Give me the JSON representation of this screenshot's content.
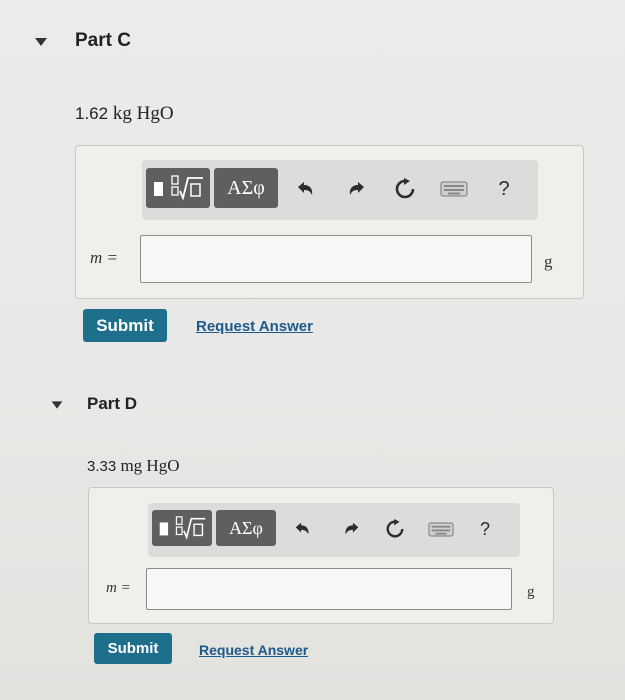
{
  "part_c": {
    "title": "Part C",
    "quantity": "1.62",
    "unit_expr": "kg HgO",
    "toolbar": {
      "greek_label": "ΑΣφ",
      "help_label": "?"
    },
    "var_label": "m =",
    "answer_value": "",
    "answer_unit": "g",
    "submit_label": "Submit",
    "request_label": "Request Answer"
  },
  "part_d": {
    "title": "Part D",
    "quantity": "3.33",
    "unit_expr": "mg HgO",
    "toolbar": {
      "greek_label": "ΑΣφ",
      "help_label": "?"
    },
    "var_label": "m =",
    "answer_value": "",
    "answer_unit": "g",
    "submit_label": "Submit",
    "request_label": "Request Answer"
  },
  "icons": {
    "collapse": "caret-down-icon",
    "templates": "fraction-sqrt-template-icon",
    "undo": "undo-icon",
    "redo": "redo-icon",
    "reset": "reset-icon",
    "keyboard": "keyboard-icon"
  },
  "colors": {
    "submit": "#1e6f8c",
    "link": "#1d5a8a",
    "toolbar_button": "#5f5f5f"
  }
}
